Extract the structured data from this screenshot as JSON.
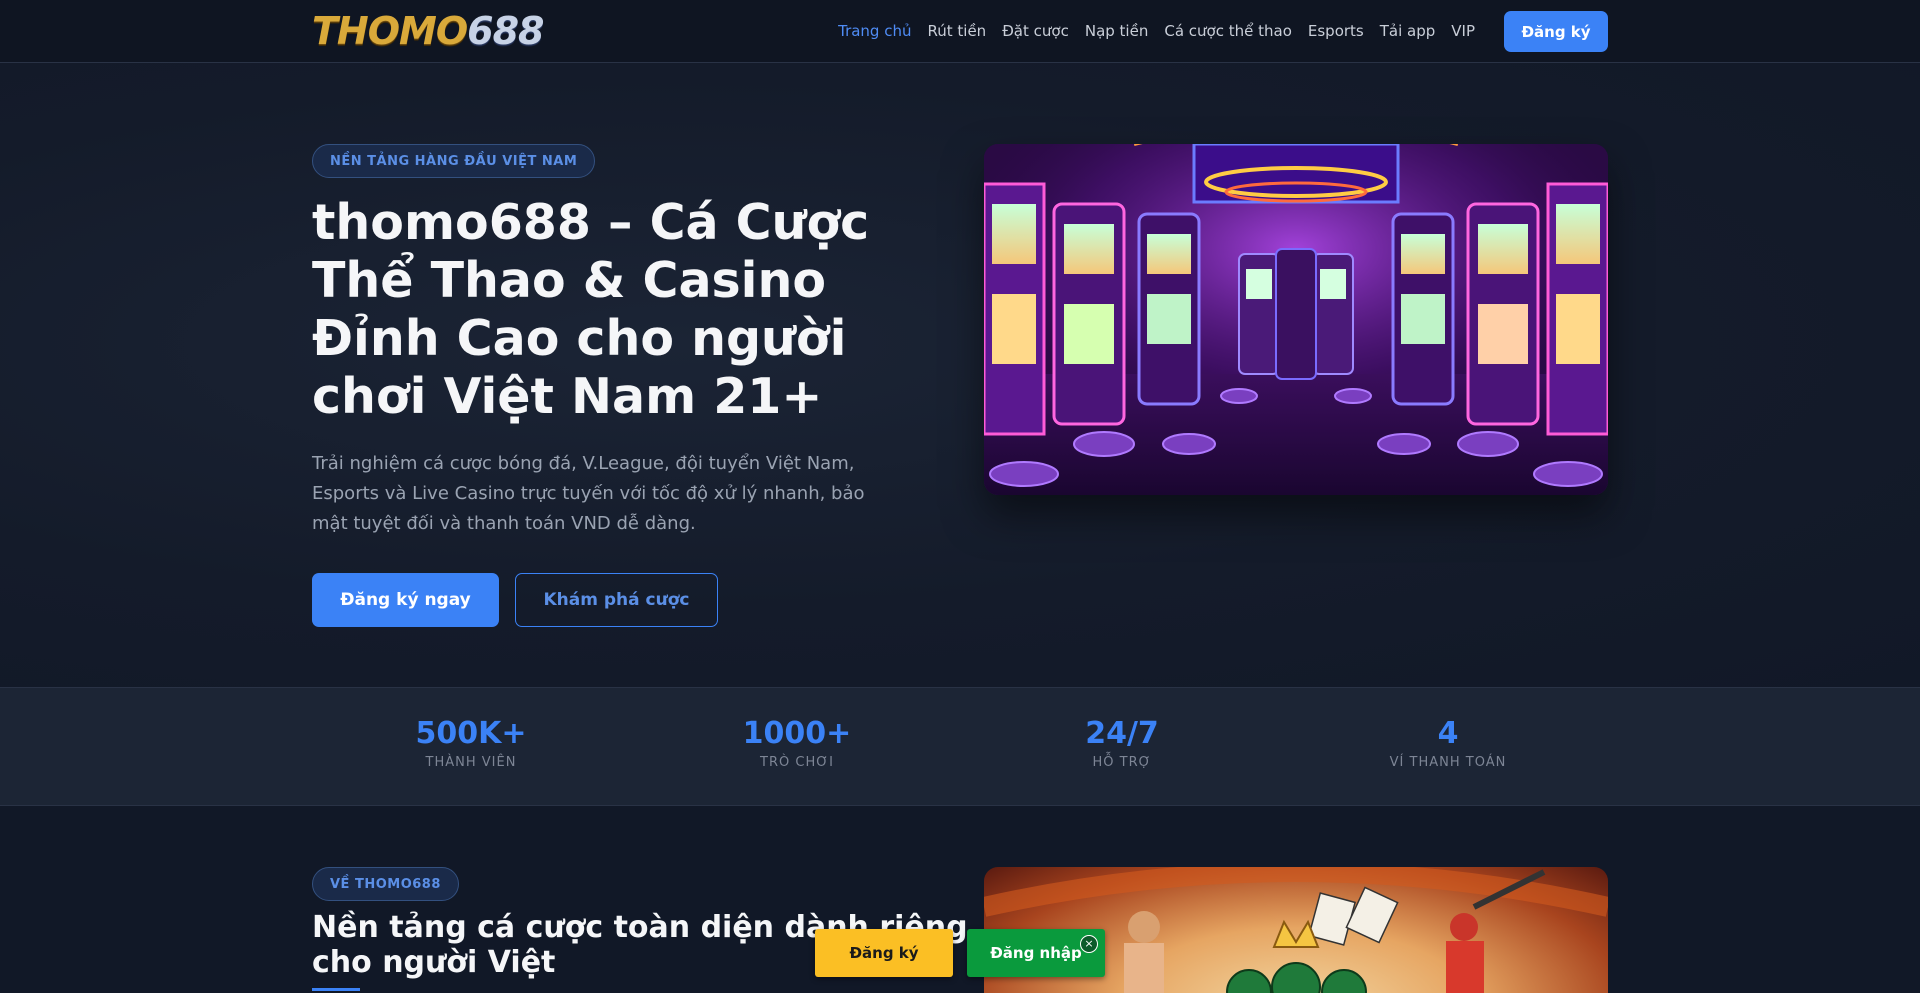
{
  "header": {
    "logo_part1": "THOMO",
    "logo_part2": "688",
    "nav": [
      {
        "label": "Trang chủ",
        "active": true
      },
      {
        "label": "Rút tiền"
      },
      {
        "label": "Đặt cược"
      },
      {
        "label": "Nạp tiền"
      },
      {
        "label": "Cá cược thể thao"
      },
      {
        "label": "Esports"
      },
      {
        "label": "Tải app"
      },
      {
        "label": "VIP"
      }
    ],
    "register_label": "Đăng ký"
  },
  "hero": {
    "badge": "NỀN TẢNG HÀNG ĐẦU VIỆT NAM",
    "title": "thomo688 – Cá Cược Thể Thao & Casino Đỉnh Cao cho người chơi Việt Nam 21+",
    "description": "Trải nghiệm cá cược bóng đá, V.League, đội tuyển Việt Nam, Esports và Live Casino trực tuyến với tốc độ xử lý nhanh, bảo mật tuyệt đối và thanh toán VND dễ dàng.",
    "primary_button": "Đăng ký ngay",
    "secondary_button": "Khám phá cược"
  },
  "stats": [
    {
      "value": "500K+",
      "label": "THÀNH VIÊN"
    },
    {
      "value": "1000+",
      "label": "TRÒ CHƠI"
    },
    {
      "value": "24/7",
      "label": "HỖ TRỢ"
    },
    {
      "value": "4",
      "label": "VÍ THANH TOÁN"
    }
  ],
  "about": {
    "badge": "VỀ THOMO688",
    "title": "Nền tảng cá cược toàn diện dành riêng cho người Việt"
  },
  "floating": {
    "register_label": "Đăng ký",
    "login_label": "Đăng nhập",
    "close_symbol": "×"
  },
  "colors": {
    "accent": "#3b82f6",
    "register_yellow": "#fbbf24",
    "login_green": "#0a9a3d"
  }
}
